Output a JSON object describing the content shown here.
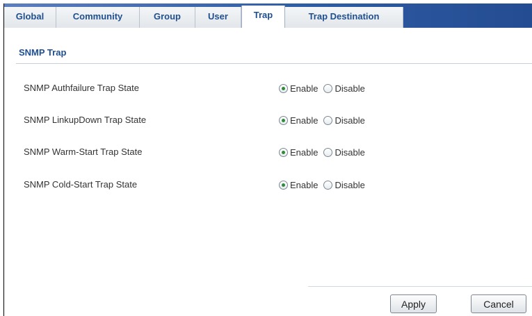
{
  "tabs": [
    {
      "label": "Global",
      "active": false
    },
    {
      "label": "Community",
      "active": false
    },
    {
      "label": "Group",
      "active": false
    },
    {
      "label": "User",
      "active": false
    },
    {
      "label": "Trap",
      "active": true
    },
    {
      "label": "Trap Destination",
      "active": false
    }
  ],
  "section": {
    "title": "SNMP Trap"
  },
  "rows": [
    {
      "label": "SNMP Authfailure Trap State",
      "enable": "Enable",
      "disable": "Disable",
      "selected": "Enable"
    },
    {
      "label": "SNMP LinkupDown Trap State",
      "enable": "Enable",
      "disable": "Disable",
      "selected": "Enable"
    },
    {
      "label": "SNMP Warm-Start Trap State",
      "enable": "Enable",
      "disable": "Disable",
      "selected": "Enable"
    },
    {
      "label": "SNMP Cold-Start Trap State",
      "enable": "Enable",
      "disable": "Disable",
      "selected": "Enable"
    }
  ],
  "buttons": {
    "apply": "Apply",
    "cancel": "Cancel"
  },
  "colors": {
    "tab_text": "#1f4f8f",
    "tabbar_blue": "#2f5da6",
    "radio_checked": "#2f8a3a"
  }
}
